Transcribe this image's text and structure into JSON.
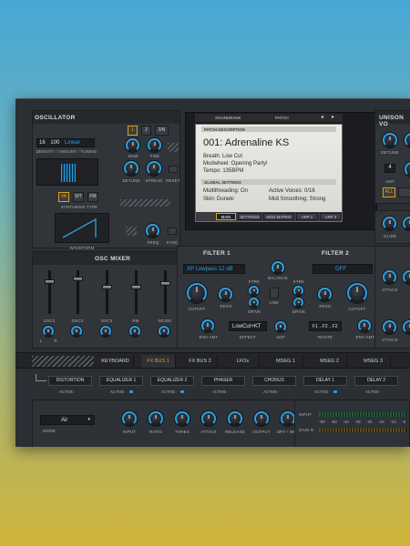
{
  "oscillator": {
    "title": "OSCILLATOR",
    "osc_buttons": [
      "1",
      "2",
      "3/N"
    ],
    "density": "16",
    "amount": "100",
    "tuning_mode": "Linear",
    "density_label": "DENSITY / AMOUNT / TUNING",
    "semi": "SEMI",
    "fine": "FINE",
    "detune": "DETUNE",
    "spread": "SPREAD",
    "reset": "RESET",
    "synth_types": [
      "VA",
      "WT",
      "FM"
    ],
    "synthesis_type": "SYNTHESIS TYPE",
    "waveform": "WAVEFORM",
    "freq": "FREQ",
    "sync": "SYNC"
  },
  "display": {
    "tabs": [
      "SOUNDBANK",
      "PATCH"
    ],
    "arrows": [
      "◂",
      "▸"
    ],
    "patch_description": "PATCH DESCRIPTION",
    "patch_name": "001: Adrenaline KS",
    "desc_lines": [
      "Breath: Low Cut",
      "Modwheel: Opening Party!",
      "Tempo: 135BPM"
    ],
    "global_settings": "GLOBAL SETTINGS",
    "global_left": [
      "Multithreading: On",
      "Skin: Duneki"
    ],
    "global_right": [
      "Active Voices: 0/16",
      "Midi Smoothing: Strong"
    ],
    "bottom_tabs": [
      "MAIN",
      "SETTINGS",
      "MOD MATRIX",
      "ARP 1",
      "ARP 2"
    ]
  },
  "unison": {
    "title": "UNISON VO",
    "detune": "DETUNE",
    "voices": "4",
    "amt": "AMT",
    "all": "ALL",
    "glide": "GLIDE",
    "attack1": "ATTACK",
    "attack2": "ATTACK",
    "attack3": "AT"
  },
  "osc_mixer": {
    "title": "OSC MIXER",
    "channels": [
      "OSC1",
      "OSC2",
      "OSC3",
      "RM",
      "NOISE"
    ],
    "fader_levels": [
      0.75,
      0.8,
      0.6,
      0.6,
      0.7
    ],
    "lr": [
      "L",
      "R"
    ]
  },
  "filters": {
    "filter1": "FILTER 1",
    "filter2": "FILTER 2",
    "type1": "XP Lowpass 12 dB",
    "type2": "OFF",
    "balance": "BALANCE",
    "cutoff": "CUTOFF",
    "reso": "RESO",
    "ktrk": "KTRK",
    "drive": "DRIVE",
    "link": "LINK",
    "env_amt": "ENV AMT",
    "effect_value": "LowCut+KT",
    "effect": "EFFECT",
    "amt": "AMT",
    "route_value": "F1→F2→F2",
    "route": "ROUTE"
  },
  "tabs": [
    "KEYBOARD",
    "FX BUS 1",
    "FX BUS 2",
    "LFOs",
    "MSEG 1",
    "MSEG 2",
    "MSEG 3"
  ],
  "active_tab": "FX BUS 1",
  "fx_chain": {
    "slots": [
      "DISTORTION",
      "EQUALIZER 1",
      "EQUALIZER 2",
      "PHASER",
      "CHORUS",
      "DELAY 1",
      "DELAY 2"
    ],
    "active": "ACTIVE ·"
  },
  "compressor": {
    "mode_value": "Air",
    "mode": "MODE",
    "knobs": [
      "INPUT",
      "RATIO",
      "THRES",
      "ATTACK",
      "RELEASE",
      "OUTPUT",
      "DRY / WET"
    ],
    "input": "INPUT",
    "gain_r": "GAIN R",
    "meter_scale": [
      "-80",
      "-60",
      "-40",
      "-35",
      "-25",
      "-15",
      "-10",
      "-5"
    ]
  },
  "colors": {
    "accent": "#2aa0e3",
    "highlight": "#e0a21a",
    "panel": "#313439"
  }
}
